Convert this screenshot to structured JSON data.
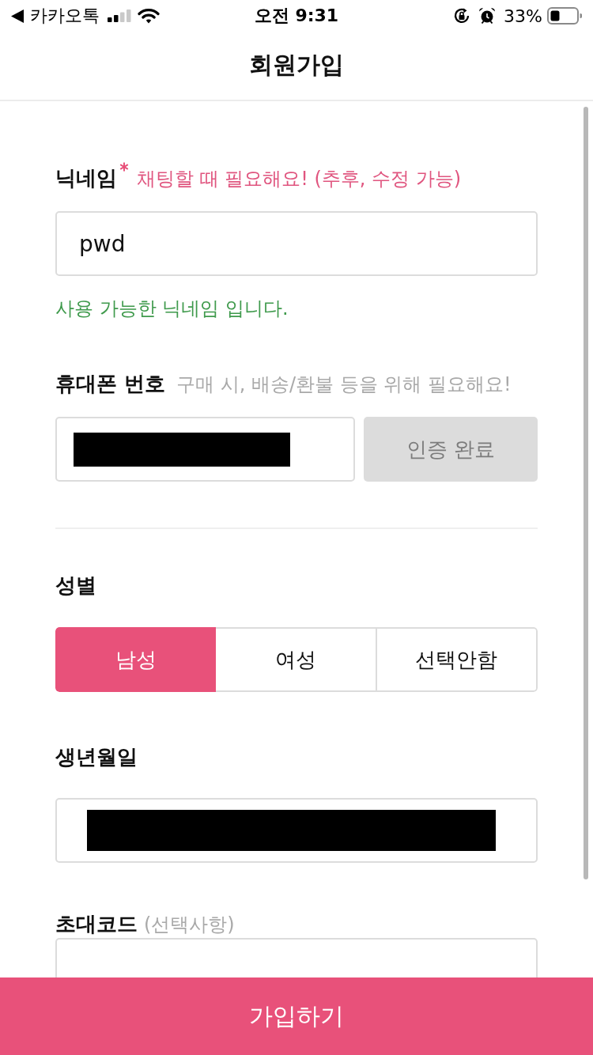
{
  "status_bar": {
    "app": "카카오톡",
    "time": "오전 9:31",
    "battery": "33%"
  },
  "header": {
    "title": "회원가입"
  },
  "nickname": {
    "label": "닉네임",
    "required": true,
    "hint": "채팅할 때 필요해요! (추후, 수정 가능)",
    "value": "pwd",
    "message": "사용 가능한 닉네임 입니다."
  },
  "phone": {
    "label": "휴대폰 번호",
    "hint": "구매 시, 배송/환불 등을 위해 필요해요!",
    "redacted": true,
    "verify_button": {
      "label": "인증 완료",
      "disabled": true
    }
  },
  "gender": {
    "label": "성별",
    "options": [
      {
        "label": "남성",
        "selected": true
      },
      {
        "label": "여성",
        "selected": false
      },
      {
        "label": "선택안함",
        "selected": false
      }
    ]
  },
  "birthdate": {
    "label": "생년월일",
    "redacted": true
  },
  "invite_code": {
    "label": "초대코드",
    "hint": "(선택사항)"
  },
  "submit_button": {
    "label": "가입하기"
  }
}
